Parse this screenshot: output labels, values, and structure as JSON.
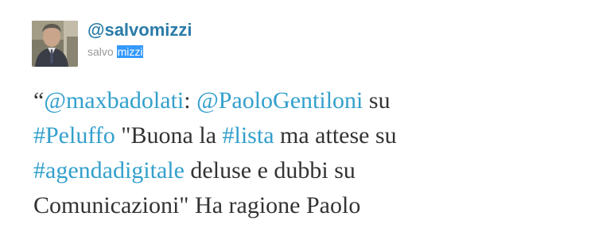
{
  "user": {
    "screen_name": "@salvomizzi",
    "first_name": "salvo",
    "last_name_selected": "mizzi"
  },
  "tweet": {
    "open_quote": "“",
    "mention1": "@maxbadolati",
    "sep1": ": ",
    "mention2": "@PaoloGentiloni",
    "t1": " su",
    "hashtag1": "#Peluffo",
    "t2": " \"Buona la ",
    "hashtag2": "#lista",
    "t3": " ma attese su",
    "hashtag3": "#agendadigitale",
    "t4": " deluse e dubbi su",
    "t5": "Comunicazioni\" Ha ragione Paolo"
  },
  "colors": {
    "screen_name": "#2a7ba8",
    "link": "#33a0cc",
    "text": "#333333",
    "full_name": "#999999",
    "selection": "#3399ff"
  }
}
